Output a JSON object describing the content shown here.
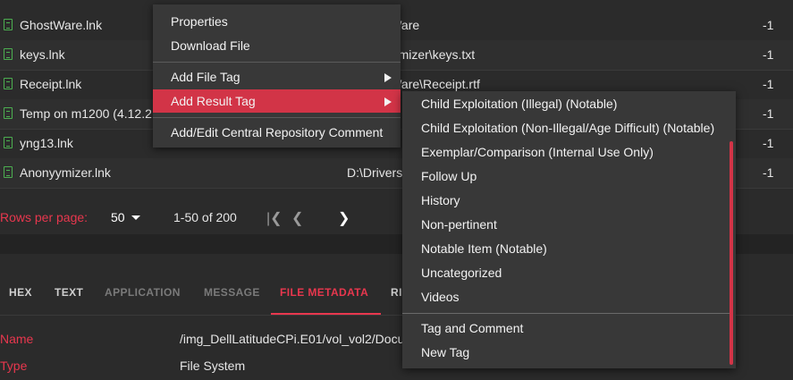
{
  "table": {
    "rows": [
      {
        "name": "GhostWare.lnk",
        "path": "s\\GhostWare",
        "num": "-1"
      },
      {
        "name": "keys.lnk",
        "path": "s\\Anonyymizer\\keys.txt",
        "num": "-1"
      },
      {
        "name": "Receipt.lnk",
        "path": "s\\GhostWare\\Receipt.rtf",
        "num": "-1"
      },
      {
        "name": "Temp on m1200 (4.12.2",
        "path": "",
        "num": "-1"
      },
      {
        "name": "yng13.lnk",
        "path": "",
        "num": "-1"
      },
      {
        "name": "Anonyymizer.lnk",
        "path": "D:\\Drivers",
        "num": "-1"
      }
    ]
  },
  "pagination": {
    "rows_per_page_label": "Rows per page:",
    "rows_per_page_value": "50",
    "range": "1-50 of 200",
    "first_icon": "first-page-icon",
    "prev_icon": "chevron-left-icon",
    "next_icon": "chevron-right-icon"
  },
  "tabs": [
    {
      "label": "HEX"
    },
    {
      "label": "TEXT"
    },
    {
      "label": "APPLICATION"
    },
    {
      "label": "MESSAGE"
    },
    {
      "label": "FILE METADATA"
    },
    {
      "label": "RI"
    }
  ],
  "metadata": [
    {
      "key": "Name",
      "value": "/img_DellLatitudeCPi.E01/vol_vol2/Docu"
    },
    {
      "key": "Type",
      "value": "File System"
    }
  ],
  "context_menu": {
    "items": [
      {
        "label": "Properties"
      },
      {
        "label": "Download File"
      },
      {
        "label": "Add File Tag"
      },
      {
        "label": "Add Result Tag"
      },
      {
        "label": "Add/Edit Central Repository Comment"
      }
    ]
  },
  "submenu": {
    "items": [
      {
        "label": "Child Exploitation (Illegal) (Notable)"
      },
      {
        "label": "Child Exploitation (Non-Illegal/Age Difficult) (Notable)"
      },
      {
        "label": "Exemplar/Comparison (Internal Use Only)"
      },
      {
        "label": "Follow Up"
      },
      {
        "label": "History"
      },
      {
        "label": "Non-pertinent"
      },
      {
        "label": "Notable Item (Notable)"
      },
      {
        "label": "Uncategorized"
      },
      {
        "label": "Videos"
      },
      {
        "label": "Tag and Comment"
      },
      {
        "label": "New Tag"
      }
    ]
  },
  "colors": {
    "accent": "#e8374e",
    "highlight": "#d23447",
    "file_icon": "#4caf50",
    "background": "#2b2b2b",
    "menu_bg": "#383838"
  }
}
